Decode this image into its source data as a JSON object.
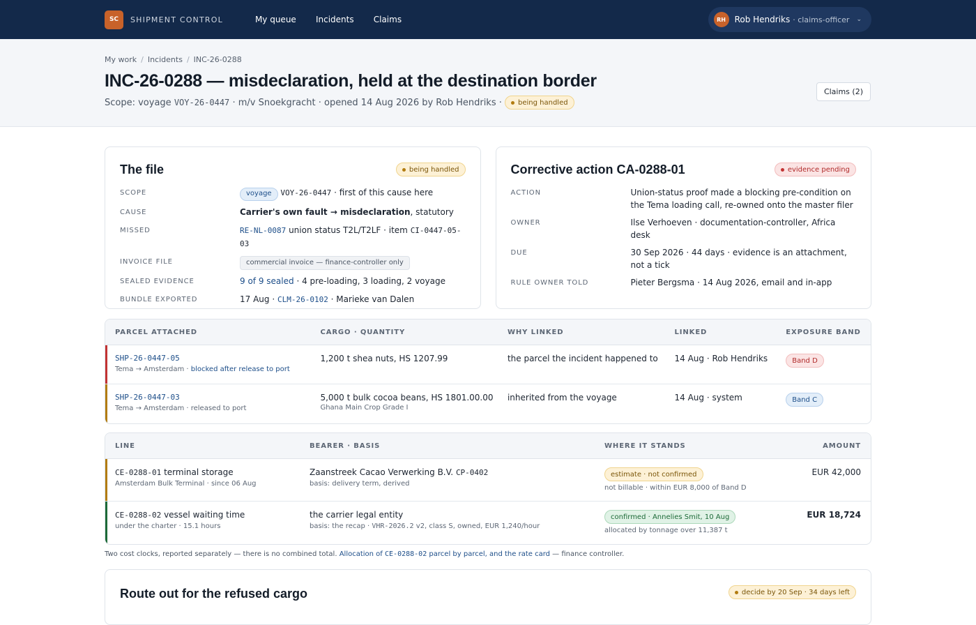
{
  "app": {
    "logo": "SC",
    "name": "SHIPMENT CONTROL"
  },
  "nav": [
    "My queue",
    "Incidents",
    "Claims"
  ],
  "user": {
    "initials": "RH",
    "name": "Rob Hendriks",
    "role": "· claims-officer"
  },
  "breadcrumb": [
    "My work",
    "Incidents",
    "INC-26-0288"
  ],
  "page": {
    "title": "INC-26-0288 — misdeclaration, held at the destination border",
    "scope_prefix": "Scope: voyage",
    "scope_code": "VOY-26-0447",
    "scope_rest": "· m/v Snoekgracht · opened 14 Aug 2026 by Rob Hendriks ·",
    "status": "being handled",
    "claims_button": "Claims (2)"
  },
  "file_card": {
    "title": "The file",
    "status": "being handled",
    "labels": {
      "scope": "SCOPE",
      "cause": "CAUSE",
      "missed": "MISSED",
      "invoice": "INVOICE FILE",
      "evidence": "SEALED EVIDENCE",
      "bundle": "BUNDLE EXPORTED"
    },
    "scope_badge": "voyage",
    "scope_code": "VOY-26-0447",
    "scope_rest": "· first of this cause here",
    "cause_bold": "Carrier's own fault → misdeclaration",
    "cause_rest": ", statutory",
    "missed_code": "RE-NL-0087",
    "missed_mid": "union status T2L/T2LF · item",
    "missed_item": "CI-0447-05-03",
    "invoice_badge": "commercial invoice — finance-controller only",
    "evidence_link": "9 of 9 sealed",
    "evidence_rest": "· 4 pre-loading, 3 loading, 2 voyage",
    "bundle_date": "17 Aug ·",
    "bundle_code": "CLM-26-0102",
    "bundle_rest": "· Marieke van Dalen"
  },
  "action_card": {
    "title": "Corrective action CA-0288-01",
    "status": "evidence pending",
    "labels": {
      "action": "ACTION",
      "owner": "OWNER",
      "due": "DUE",
      "rule": "RULE OWNER TOLD"
    },
    "action": "Union-status proof made a blocking pre-condition on the Tema loading call, re-owned onto the master filer",
    "owner": "Ilse Verhoeven · documentation-controller, Africa desk",
    "due": "30 Sep 2026 · 44 days · evidence is an attachment, not a tick",
    "rule": "Pieter Bergsma · 14 Aug 2026, email and in-app"
  },
  "parcels": {
    "headers": [
      "PARCEL ATTACHED",
      "CARGO · QUANTITY",
      "WHY LINKED",
      "LINKED",
      "EXPOSURE BAND"
    ],
    "rows": [
      {
        "code": "SHP-26-0447-05",
        "route": "Tema → Amsterdam ·",
        "status": "blocked after release to port",
        "cargo": "1,200 t shea nuts, HS 1207.99",
        "cargo_sub": "",
        "why": "the parcel the incident happened to",
        "linked": "14 Aug · Rob Hendriks",
        "band": "Band D",
        "accent": "#c23333"
      },
      {
        "code": "SHP-26-0447-03",
        "route": "Tema → Amsterdam ·",
        "status": "released to port",
        "cargo": "5,000 t bulk cocoa beans, HS 1801.00.00",
        "cargo_sub": "Ghana Main Crop Grade I",
        "why": "inherited from the voyage",
        "linked": "14 Aug · system",
        "band": "Band C",
        "accent": "#b27c10"
      }
    ]
  },
  "costs": {
    "headers": [
      "LINE",
      "BEARER · BASIS",
      "WHERE IT STANDS",
      "AMOUNT"
    ],
    "rows": [
      {
        "code": "CE-0288-01",
        "name": "terminal storage",
        "sub": "Amsterdam Bulk Terminal · since 06 Aug",
        "bearer": "Zaanstreek Cacao Verwerking B.V.",
        "bearer_code": "CP-0402",
        "basis_prefix": "basis: delivery term, derived",
        "basis_code": "",
        "basis_rest": "",
        "stand": "estimate · not confirmed",
        "stand_sub": "not billable · within EUR 8,000 of Band D",
        "amount": "EUR 42,000",
        "accent": "#b27c10"
      },
      {
        "code": "CE-0288-02",
        "name": "vessel waiting time",
        "sub": "under the charter · 15.1 hours",
        "bearer": "the carrier legal entity",
        "bearer_code": "",
        "basis_prefix": "basis: the recap ·",
        "basis_code": "VHR-2026.2",
        "basis_rest": "v2, class S, owned, EUR 1,240/hour",
        "stand": "confirmed · Annelies Smit, 10 Aug",
        "stand_sub": "allocated by tonnage over 11,387 t",
        "amount": "EUR 18,724",
        "accent": "#1d6a38"
      }
    ]
  },
  "footnote": {
    "text": "Two cost clocks, reported separately — there is no combined total.",
    "link_a": "Allocation of",
    "link_code": "CE-0288-02",
    "link_b": "parcel by parcel, and the rate card",
    "tail": "— finance controller."
  },
  "route": {
    "title": "Route out for the refused cargo",
    "status": "decide by 20 Sep · 34 days left"
  },
  "colors": {
    "navy": "#13294a",
    "accent": "#c8622a",
    "link": "#1d4e89"
  }
}
